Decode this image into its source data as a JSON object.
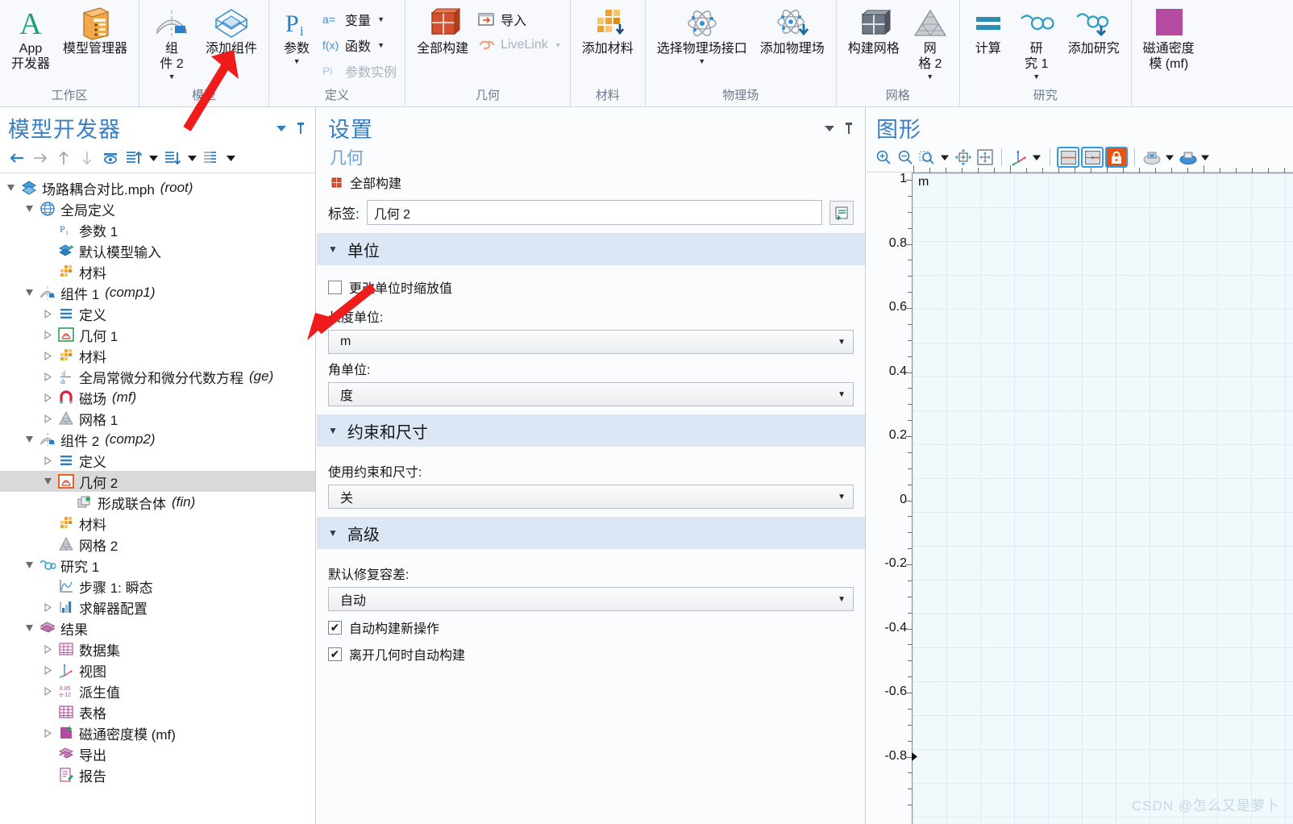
{
  "ribbon": {
    "groups": [
      {
        "title": "工作区",
        "items": [
          {
            "label": "App\n开发器",
            "icon": "app-developer-icon"
          },
          {
            "label": "模型管理器",
            "icon": "model-manager-icon"
          }
        ]
      },
      {
        "title": "模型",
        "items": [
          {
            "label": "组\n件 2",
            "icon": "component-icon",
            "caret": true
          },
          {
            "label": "添加组件",
            "icon": "add-component-icon",
            "caret": true
          }
        ]
      },
      {
        "title": "定义",
        "items": [
          {
            "label": "参数",
            "icon": "parameters-icon",
            "caret": true
          }
        ],
        "small": [
          {
            "pre": "a=",
            "label": "变量",
            "caret": true,
            "disabled": false
          },
          {
            "pre": "f(x)",
            "label": "函数",
            "caret": true,
            "disabled": false
          },
          {
            "pre": "Pi",
            "label": "参数实例",
            "caret": false,
            "disabled": true
          }
        ]
      },
      {
        "title": "几何",
        "items": [
          {
            "label": "全部构建",
            "icon": "build-all-icon"
          }
        ],
        "small": [
          {
            "pre": "import",
            "label": "导入",
            "caret": false,
            "disabled": false
          },
          {
            "pre": "livelink",
            "label": "LiveLink",
            "caret": true,
            "disabled": true
          }
        ]
      },
      {
        "title": "材料",
        "items": [
          {
            "label": "添加材料",
            "icon": "add-material-icon"
          }
        ]
      },
      {
        "title": "物理场",
        "items": [
          {
            "label": "选择物理场接口",
            "icon": "physics-interface-icon",
            "caret": true
          },
          {
            "label": "添加物理场",
            "icon": "add-physics-icon"
          }
        ]
      },
      {
        "title": "网格",
        "items": [
          {
            "label": "构建网格",
            "icon": "build-mesh-icon"
          },
          {
            "label": "网\n格 2",
            "icon": "mesh-icon",
            "caret": true
          }
        ]
      },
      {
        "title": "研究",
        "items": [
          {
            "label": "计算",
            "icon": "compute-icon"
          },
          {
            "label": "研\n究 1",
            "icon": "study-icon",
            "caret": true
          },
          {
            "label": "添加研究",
            "icon": "add-study-icon"
          }
        ]
      },
      {
        "title": "",
        "items": [
          {
            "label": "磁通密度\n模 (mf)",
            "icon": "magnetic-flux-plot-icon"
          }
        ]
      }
    ]
  },
  "model_builder": {
    "title": "模型开发器",
    "toolbar": [
      "back-icon",
      "forward-icon",
      "up-icon",
      "down-icon",
      "show-icon",
      "collapse-icon",
      "collapse-caret",
      "expand-icon",
      "expand-caret",
      "list-icon",
      "list-caret"
    ],
    "tree": [
      {
        "label": "场路耦合对比.mph",
        "suffix": "(root)",
        "depth": 0,
        "arrow": "open",
        "icon": "root-icon"
      },
      {
        "label": "全局定义",
        "suffix": "",
        "depth": 1,
        "arrow": "open",
        "icon": "global-definitions-icon"
      },
      {
        "label": "参数 1",
        "suffix": "",
        "depth": 2,
        "arrow": "none",
        "icon": "parameters-icon"
      },
      {
        "label": "默认模型输入",
        "suffix": "",
        "depth": 2,
        "arrow": "none",
        "icon": "default-model-inputs-icon"
      },
      {
        "label": "材料",
        "suffix": "",
        "depth": 2,
        "arrow": "none",
        "icon": "materials-icon"
      },
      {
        "label": "组件 1",
        "suffix": "(comp1)",
        "depth": 1,
        "arrow": "open",
        "icon": "component-icon"
      },
      {
        "label": "定义",
        "suffix": "",
        "depth": 2,
        "arrow": "closed",
        "icon": "definitions-icon"
      },
      {
        "label": "几何 1",
        "suffix": "",
        "depth": 2,
        "arrow": "closed",
        "icon": "geometry-green-icon"
      },
      {
        "label": "材料",
        "suffix": "",
        "depth": 2,
        "arrow": "closed",
        "icon": "materials-icon"
      },
      {
        "label": "全局常微分和微分代数方程",
        "suffix": "(ge)",
        "depth": 2,
        "arrow": "closed",
        "icon": "ode-icon"
      },
      {
        "label": "磁场",
        "suffix": "(mf)",
        "depth": 2,
        "arrow": "closed",
        "icon": "magnetic-fields-icon"
      },
      {
        "label": "网格 1",
        "suffix": "",
        "depth": 2,
        "arrow": "closed",
        "icon": "mesh-icon"
      },
      {
        "label": "组件 2",
        "suffix": "(comp2)",
        "depth": 1,
        "arrow": "open",
        "icon": "component-icon"
      },
      {
        "label": "定义",
        "suffix": "",
        "depth": 2,
        "arrow": "closed",
        "icon": "definitions-icon"
      },
      {
        "label": "几何 2",
        "suffix": "",
        "depth": 2,
        "arrow": "open",
        "icon": "geometry-red-icon",
        "selected": true
      },
      {
        "label": "形成联合体",
        "suffix": "(fin)",
        "depth": 3,
        "arrow": "none",
        "icon": "form-union-icon"
      },
      {
        "label": "材料",
        "suffix": "",
        "depth": 2,
        "arrow": "none",
        "icon": "materials-icon"
      },
      {
        "label": "网格 2",
        "suffix": "",
        "depth": 2,
        "arrow": "none",
        "icon": "mesh-icon"
      },
      {
        "label": "研究 1",
        "suffix": "",
        "depth": 1,
        "arrow": "open",
        "icon": "study-icon"
      },
      {
        "label": "步骤 1: 瞬态",
        "suffix": "",
        "depth": 2,
        "arrow": "none",
        "icon": "step-transient-icon"
      },
      {
        "label": "求解器配置",
        "suffix": "",
        "depth": 2,
        "arrow": "closed",
        "icon": "solver-config-icon"
      },
      {
        "label": "结果",
        "suffix": "",
        "depth": 1,
        "arrow": "open",
        "icon": "results-icon"
      },
      {
        "label": "数据集",
        "suffix": "",
        "depth": 2,
        "arrow": "closed",
        "icon": "datasets-icon"
      },
      {
        "label": "视图",
        "suffix": "",
        "depth": 2,
        "arrow": "closed",
        "icon": "views-icon"
      },
      {
        "label": "派生值",
        "suffix": "",
        "depth": 2,
        "arrow": "closed",
        "icon": "derived-values-icon"
      },
      {
        "label": "表格",
        "suffix": "",
        "depth": 2,
        "arrow": "none",
        "icon": "tables-icon"
      },
      {
        "label": "磁通密度模 (mf)",
        "suffix": "",
        "depth": 2,
        "arrow": "closed",
        "icon": "magnetic-flux-plot-icon"
      },
      {
        "label": "导出",
        "suffix": "",
        "depth": 2,
        "arrow": "none",
        "icon": "export-icon"
      },
      {
        "label": "报告",
        "suffix": "",
        "depth": 2,
        "arrow": "none",
        "icon": "report-icon"
      }
    ]
  },
  "settings": {
    "title": "设置",
    "subtitle": "几何",
    "build_all": "全部构建",
    "label_caption": "标签:",
    "label_value": "几何 2",
    "sections": [
      {
        "header": "单位",
        "checkbox_label": "更改单位时缩放值",
        "checkbox_checked": false,
        "fields": [
          {
            "label": "长度单位:",
            "value": "m"
          },
          {
            "label": "角单位:",
            "value": "度"
          }
        ]
      },
      {
        "header": "约束和尺寸",
        "fields": [
          {
            "label": "使用约束和尺寸:",
            "value": "关"
          }
        ]
      },
      {
        "header": "高级",
        "fields": [
          {
            "label": "默认修复容差:",
            "value": "自动"
          }
        ],
        "checkboxes": [
          {
            "label": "自动构建新操作",
            "checked": true
          },
          {
            "label": "离开几何时自动构建",
            "checked": true
          }
        ]
      }
    ]
  },
  "graphics": {
    "title": "图形",
    "toolbar": [
      "zoom-in-icon",
      "zoom-out-icon",
      "zoom-box-icon",
      "zoom-caret",
      "zoom-extents-icon",
      "zoom-fit-icon",
      "axis-orientation-icon",
      "axis-caret",
      "scene-light-icon",
      "transparency-icon",
      "lock-icon",
      "select-icon",
      "select-caret",
      "select-box-icon",
      "select-box-caret"
    ],
    "unit_label": "m",
    "y_ticks": [
      "1",
      "0.8",
      "0.6",
      "0.4",
      "0.2",
      "0",
      "-0.2",
      "-0.4",
      "-0.6",
      "-0.8"
    ],
    "watermark": "CSDN @怎么又是萝卜"
  }
}
